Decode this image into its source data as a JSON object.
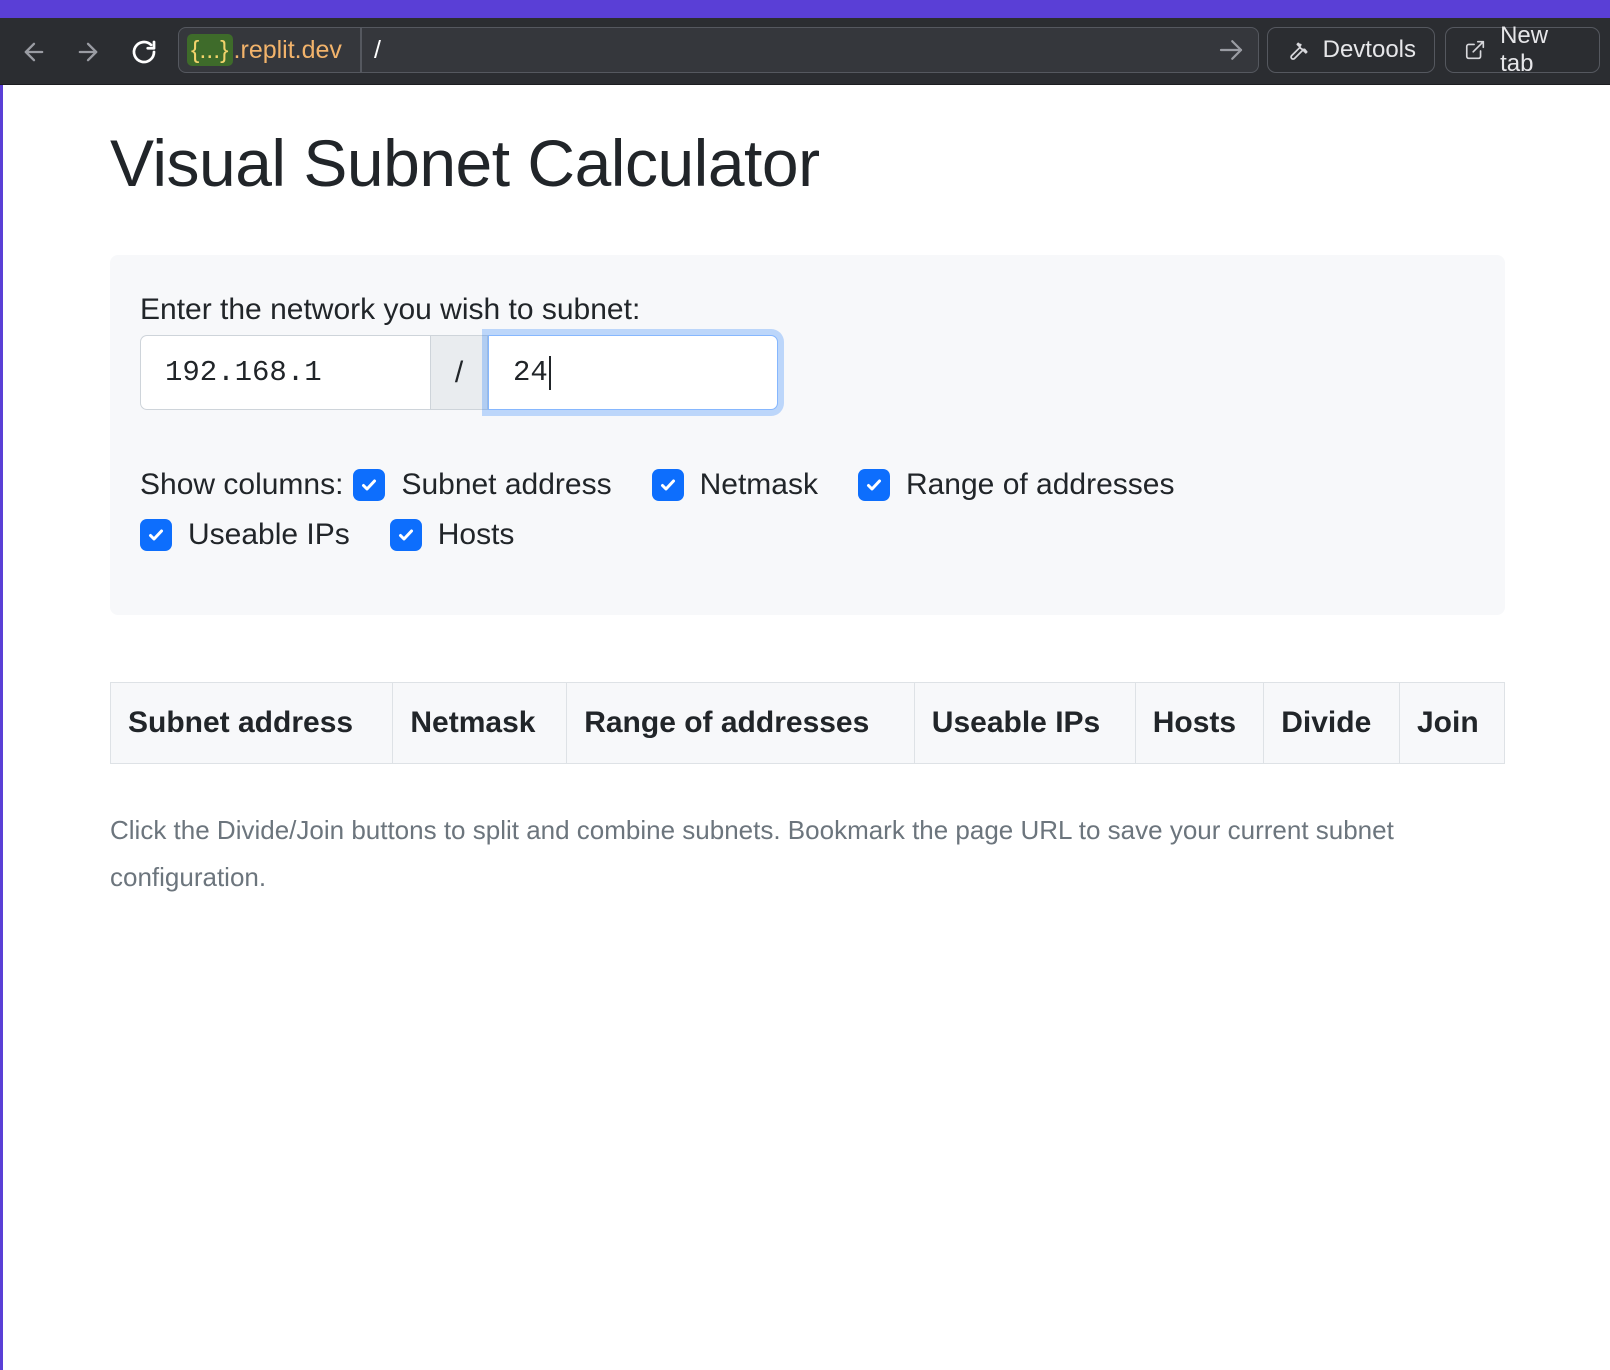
{
  "browser": {
    "host_badge": "{...}",
    "host": ".replit.dev",
    "path": "/",
    "devtools_label": "Devtools",
    "new_tab_label": "New tab"
  },
  "page": {
    "title": "Visual Subnet Calculator",
    "network_prompt": "Enter the network you wish to subnet:",
    "network_address": "192.168.1",
    "slash": "/",
    "netmask_bits": "24",
    "show_columns_label": "Show columns:",
    "column_toggles": [
      {
        "label": "Subnet address",
        "checked": true
      },
      {
        "label": "Netmask",
        "checked": true
      },
      {
        "label": "Range of addresses",
        "checked": true
      },
      {
        "label": "Useable IPs",
        "checked": true
      },
      {
        "label": "Hosts",
        "checked": true
      }
    ],
    "table_headers": [
      "Subnet address",
      "Netmask",
      "Range of addresses",
      "Useable IPs",
      "Hosts",
      "Divide",
      "Join"
    ],
    "help_text": "Click the Divide/Join buttons to split and combine subnets. Bookmark the page URL to save your current subnet configuration."
  },
  "colors": {
    "accent": "#5a3fd6",
    "checkbox": "#0d6efd",
    "browser_bar": "#2b2d31"
  }
}
